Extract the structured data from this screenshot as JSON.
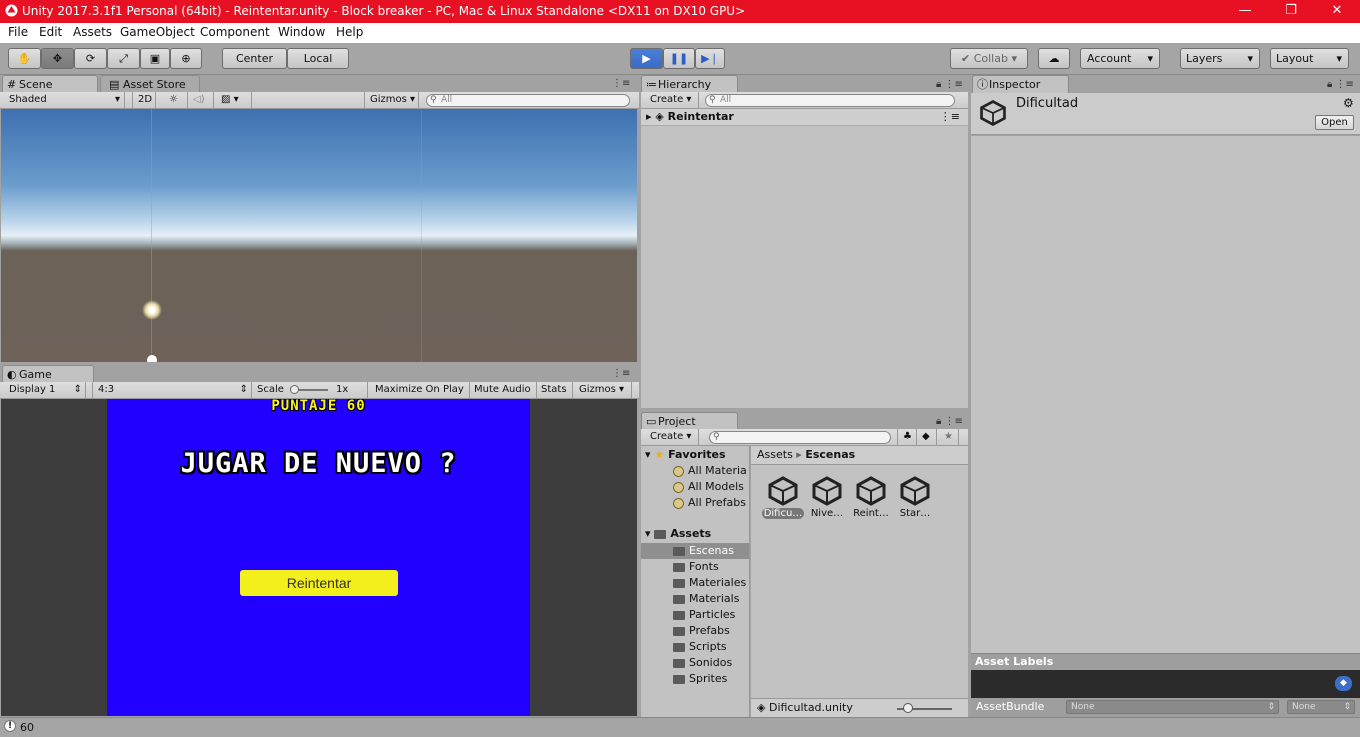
{
  "window": {
    "title": "Unity 2017.3.1f1 Personal (64bit) - Reintentar.unity - Block breaker - PC, Mac & Linux Standalone <DX11 on DX10 GPU>",
    "minimize": "—",
    "maximize": "❐",
    "close": "✕"
  },
  "menu": [
    "File",
    "Edit",
    "Assets",
    "GameObject",
    "Component",
    "Window",
    "Help"
  ],
  "toolbar": {
    "pivot": "Center",
    "space": "Local",
    "collab": "Collab",
    "account": "Account",
    "layers": "Layers",
    "layout": "Layout"
  },
  "scene": {
    "tab": "Scene",
    "tab2": "Asset Store",
    "shading": "Shaded",
    "mode2d": "2D",
    "gizmos": "Gizmos",
    "search_placeholder": "All"
  },
  "game": {
    "tab": "Game",
    "display": "Display 1",
    "aspect": "4:3",
    "scale_label": "Scale",
    "scale_value": "1x",
    "maximize": "Maximize On Play",
    "mute": "Mute Audio",
    "stats": "Stats",
    "gizmos": "Gizmos",
    "score": "PUNTAJE 60",
    "heading": "JUGAR DE NUEVO ?",
    "button": "Reintentar"
  },
  "hierarchy": {
    "tab": "Hierarchy",
    "create": "Create",
    "search_placeholder": "All",
    "scene_name": "Reintentar"
  },
  "project": {
    "tab": "Project",
    "create": "Create",
    "favorites": "Favorites",
    "fav_items": [
      "All Materia",
      "All Models",
      "All Prefabs"
    ],
    "assets_label": "Assets",
    "folders": [
      "Escenas",
      "Fonts",
      "Materiales",
      "Materials",
      "Particles",
      "Prefabs",
      "Scripts",
      "Sonidos",
      "Sprites"
    ],
    "breadcrumb_root": "Assets",
    "breadcrumb_current": "Escenas",
    "files": [
      "Dificu…",
      "Nive…",
      "Reint…",
      "Star…"
    ],
    "selected_file": "Dificultad.unity"
  },
  "inspector": {
    "tab": "Inspector",
    "object_name": "Dificultad",
    "open": "Open",
    "asset_labels": "Asset Labels",
    "asset_bundle": "AssetBundle",
    "bundle_value": "None",
    "variant_value": "None"
  },
  "status": {
    "message": "60"
  },
  "colors": {
    "game_bg": "#2200ff",
    "button": "#f2ef1c",
    "title_red": "#e81123"
  }
}
